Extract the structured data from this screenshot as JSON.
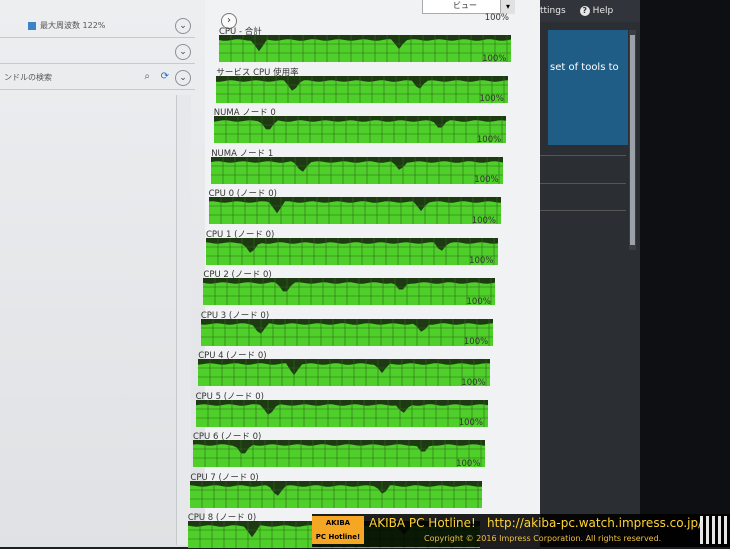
{
  "left_pane": {
    "row1_text": "最大周波数 122%",
    "row2_text": "",
    "search_text": "ンドルの検索"
  },
  "perf": {
    "expand_glyph": "›",
    "view_label": "ビュー",
    "graph_color": "#4fcf2a",
    "blocks": [
      {
        "label": "CPU - 合計",
        "percent": "100%"
      },
      {
        "label": "サービス CPU 使用率",
        "percent": "100%"
      },
      {
        "label": "NUMA ノード 0",
        "percent": "100%"
      },
      {
        "label": "NUMA ノード 1",
        "percent": "100%"
      },
      {
        "label": "CPU 0 (ノード 0)",
        "percent": "100%"
      },
      {
        "label": "CPU 1 (ノード 0)",
        "percent": "100%"
      },
      {
        "label": "CPU 2 (ノード 0)",
        "percent": "100%"
      },
      {
        "label": "CPU 3 (ノード 0)",
        "percent": "100%"
      },
      {
        "label": "CPU 4 (ノード 0)",
        "percent": "100%"
      },
      {
        "label": "CPU 5 (ノード 0)",
        "percent": "100%"
      },
      {
        "label": "CPU 6 (ノード 0)",
        "percent": "100%"
      },
      {
        "label": "CPU 7 (ノード 0)",
        "percent": "100%"
      },
      {
        "label": "CPU 8 (ノード 0)",
        "percent": ""
      }
    ]
  },
  "right_window": {
    "settings_label": "ttings",
    "help_label": "Help",
    "tile_text": "set of tools to"
  },
  "watermark": {
    "logo_top": "AKIBA",
    "logo_bottom": "PC Hotline!",
    "title": "AKIBA PC Hotline!",
    "url": "http://akiba-pc.watch.impress.co.jp/",
    "copyright": "Copyright © 2016 Impress Corporation. All rights reserved."
  }
}
